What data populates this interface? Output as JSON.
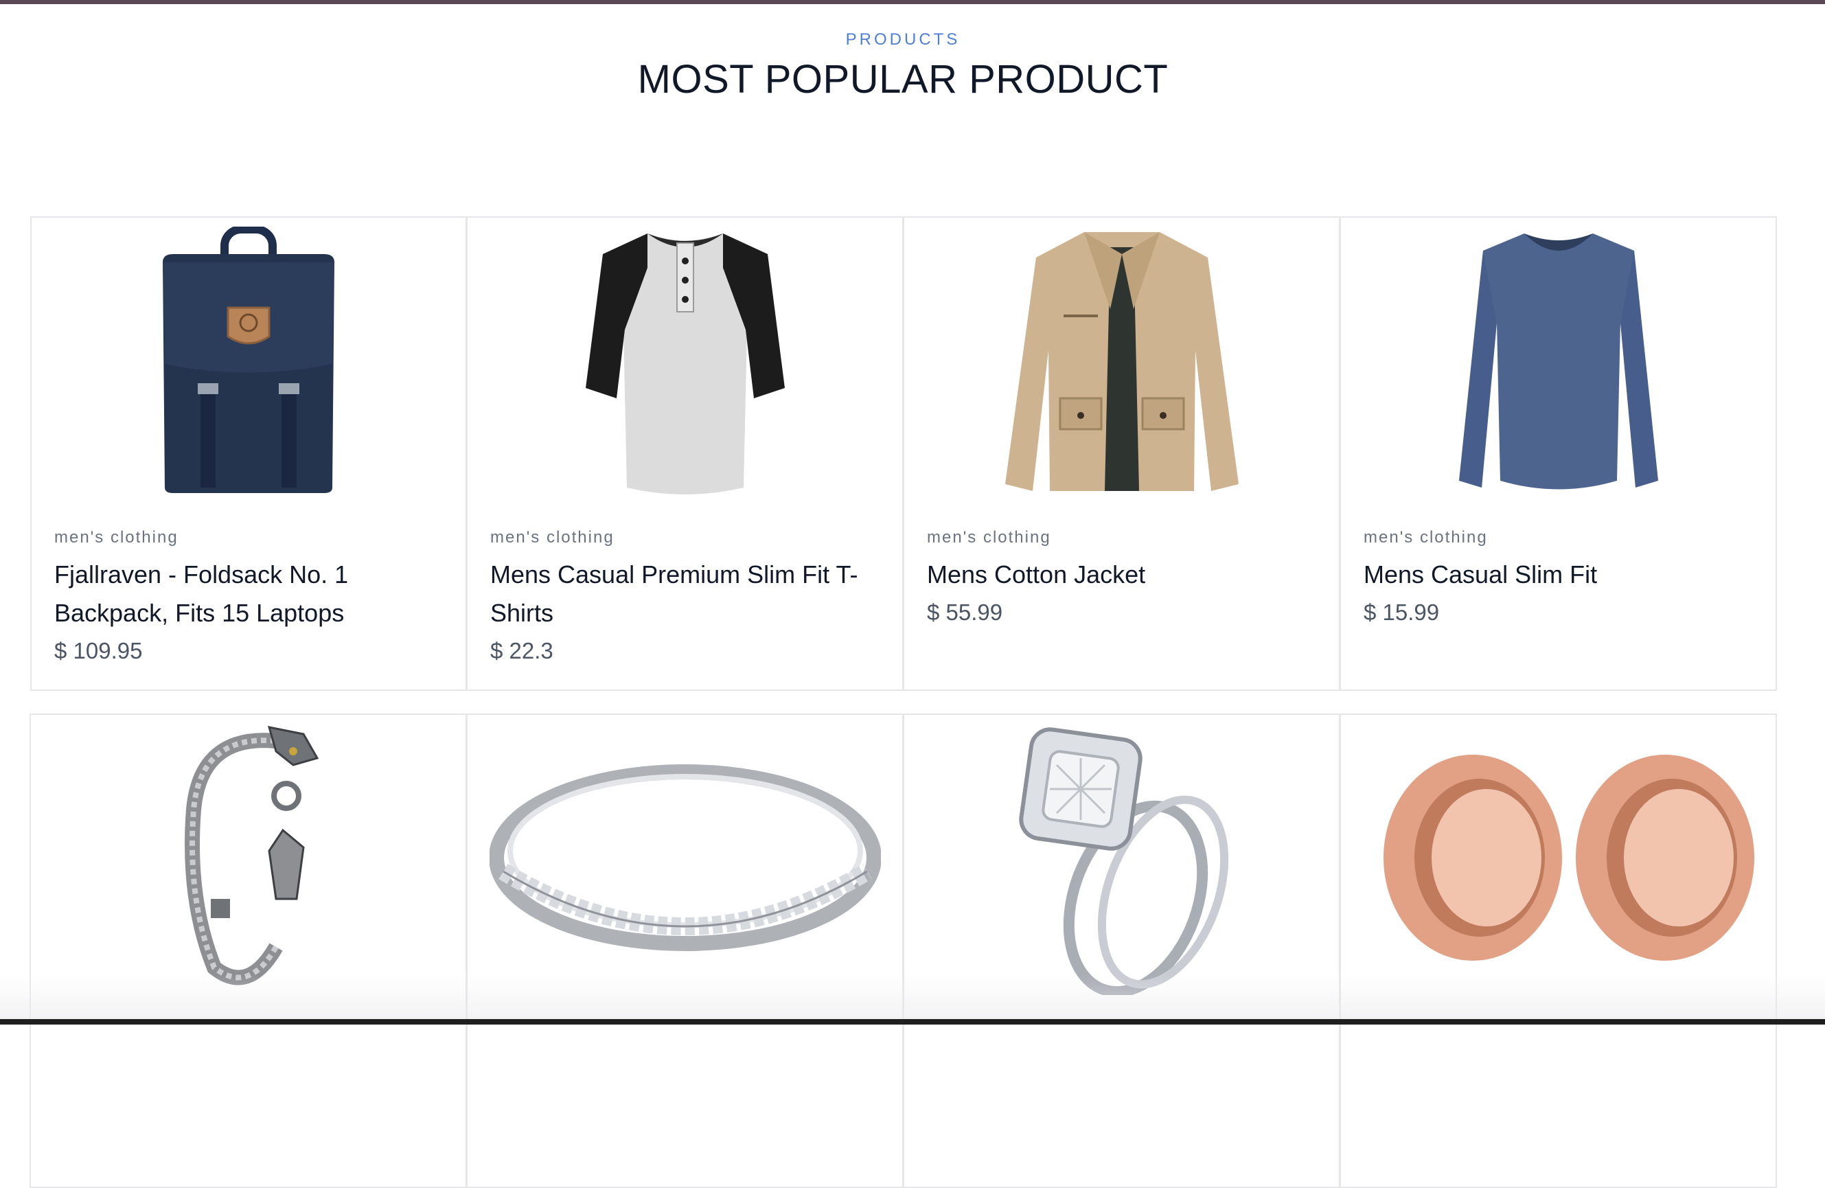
{
  "header": {
    "eyebrow": "PRODUCTS",
    "title": "MOST POPULAR PRODUCT"
  },
  "products": [
    {
      "category": "men's clothing",
      "name": "Fjallraven - Foldsack No. 1 Backpack, Fits 15 Laptops",
      "price": "$ 109.95",
      "icon": "backpack-image"
    },
    {
      "category": "men's clothing",
      "name": "Mens Casual Premium Slim Fit T-Shirts",
      "price": "$ 22.3",
      "icon": "raglan-tshirt-image"
    },
    {
      "category": "men's clothing",
      "name": "Mens Cotton Jacket",
      "price": "$ 55.99",
      "icon": "cotton-jacket-image"
    },
    {
      "category": "men's clothing",
      "name": "Mens Casual Slim Fit",
      "price": "$ 15.99",
      "icon": "long-sleeve-shirt-image"
    },
    {
      "icon": "dragon-bracelet-image"
    },
    {
      "icon": "silver-band-ring-image"
    },
    {
      "icon": "diamond-ring-set-image"
    },
    {
      "icon": "rose-gold-plugs-image"
    }
  ],
  "colors": {
    "accent": "#4f7fd6",
    "title": "#111827",
    "border": "#e5e7eb",
    "category": "#6b7280",
    "price": "#4b5563"
  }
}
